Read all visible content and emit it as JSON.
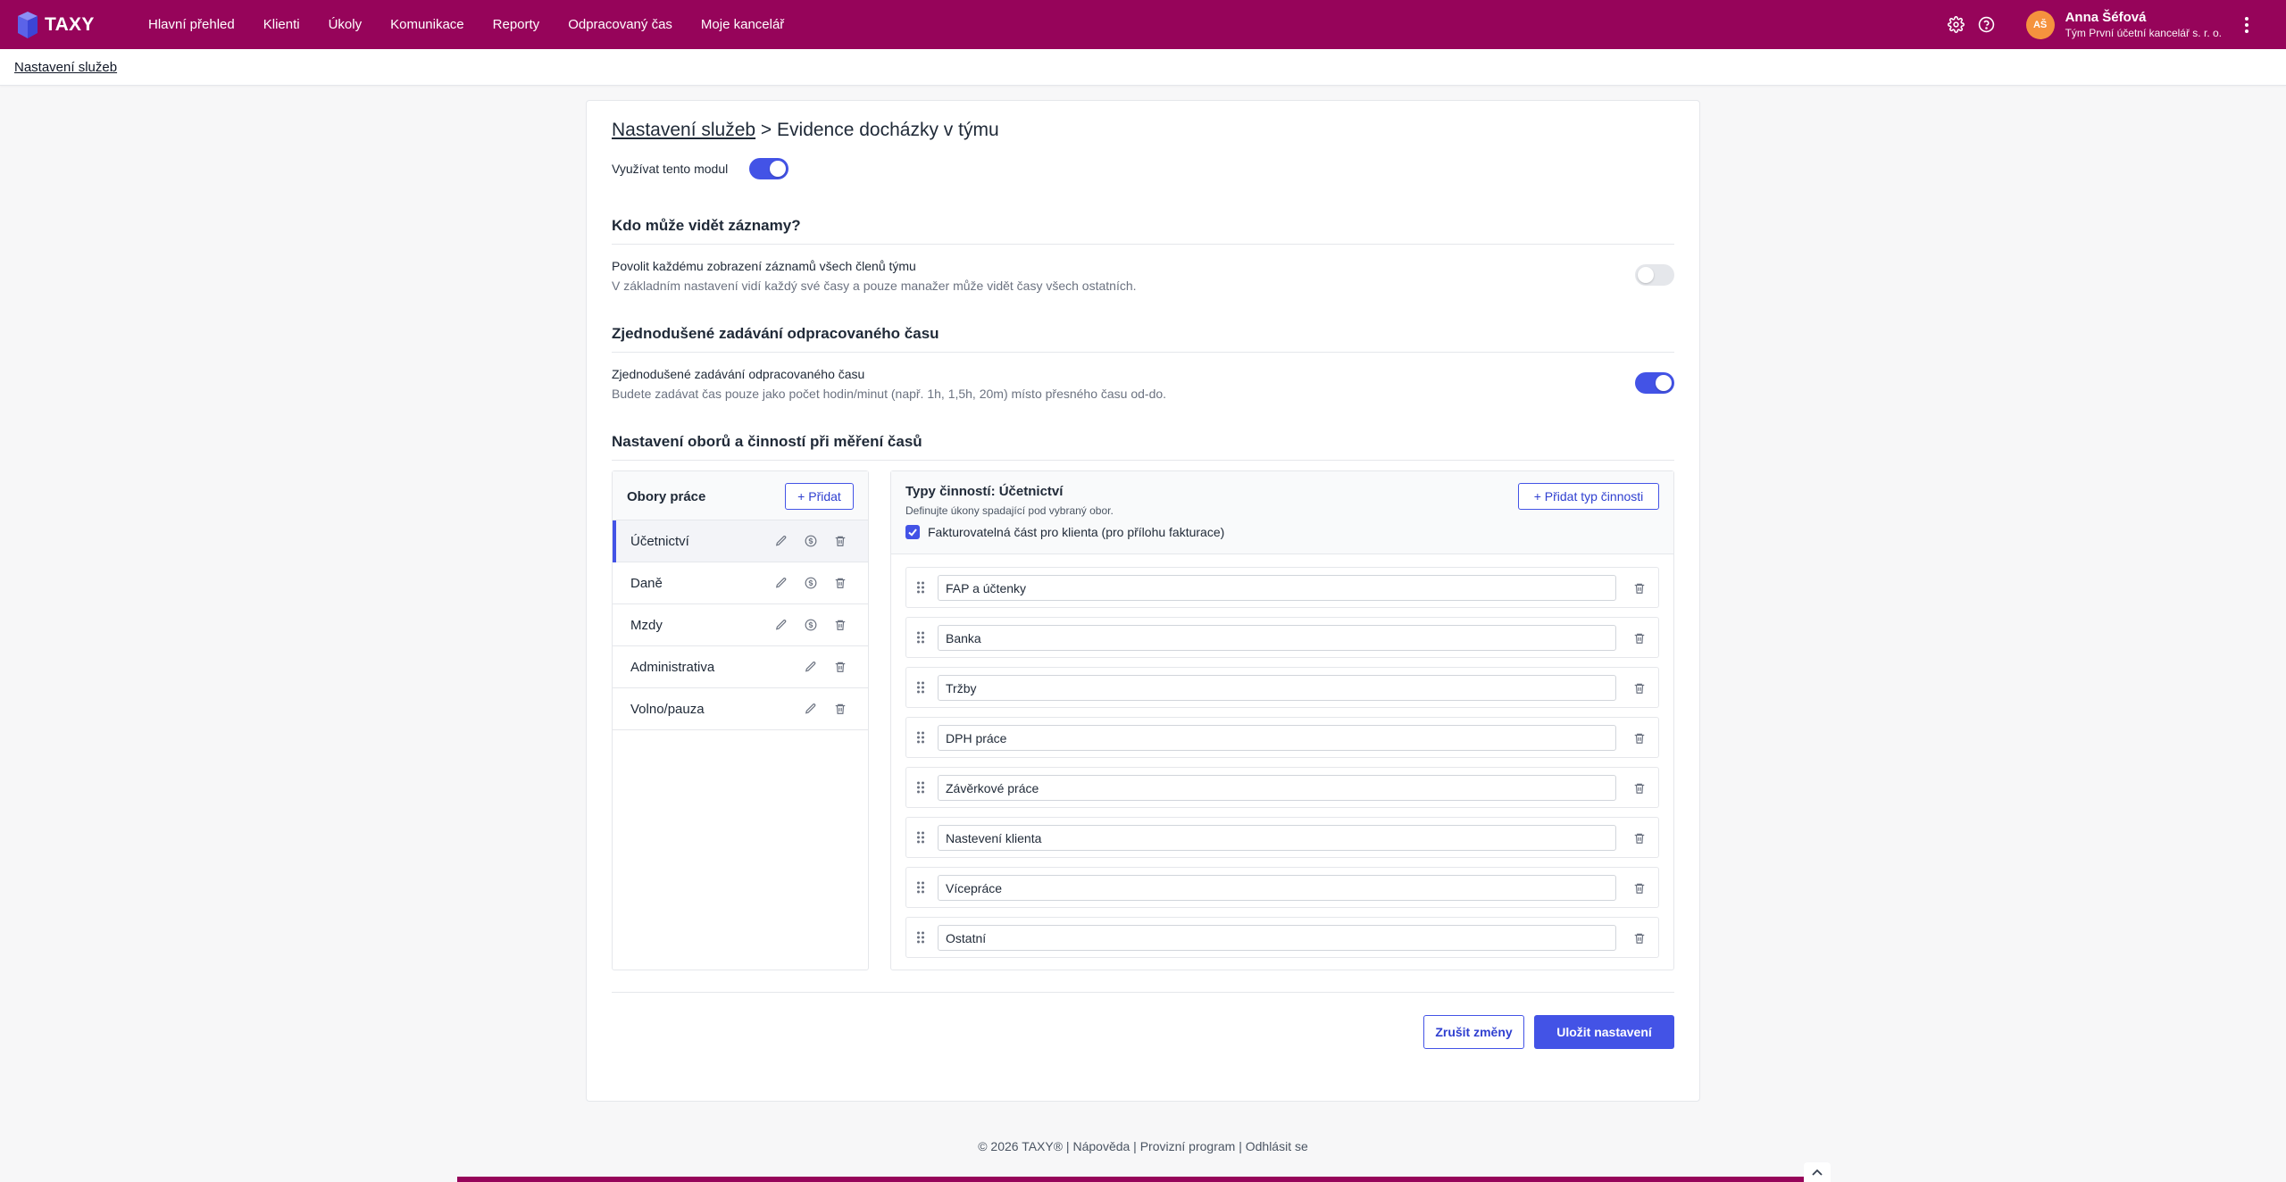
{
  "app": {
    "brand": "TAXY"
  },
  "nav": [
    "Hlavní přehled",
    "Klienti",
    "Úkoly",
    "Komunikace",
    "Reporty",
    "Odpracovaný čas",
    "Moje kancelář"
  ],
  "user": {
    "initials": "AŠ",
    "name": "Anna Šéfová",
    "org": "Tým První účetní kancelář s. r. o."
  },
  "breadcrumb": "Nastavení služeb",
  "page": {
    "crumb_link": "Nastavení služeb",
    "crumb_sep": " > ",
    "title": "Evidence docházky v týmu",
    "module_label": "Využívat tento modul",
    "module_enabled": true
  },
  "sections": {
    "visibility": {
      "heading": "Kdo může vidět záznamy?",
      "setting_title": "Povolit každému zobrazení záznamů všech členů týmu",
      "setting_desc": "V základním nastavení vidí každý své časy a pouze manažer může vidět časy všech ostatních.",
      "enabled": false
    },
    "simplified": {
      "heading": "Zjednodušené zadávání odpracovaného času",
      "setting_title": "Zjednodušené zadávání odpracovaného času",
      "setting_desc": "Budete zadávat čas pouze jako počet hodin/minut (např. 1h, 1,5h, 20m) místo přesného času od-do.",
      "enabled": true
    },
    "fields": {
      "heading": "Nastavení oborů a činností při měření časů"
    }
  },
  "work_fields": {
    "title": "Obory práce",
    "add_label": "+ Přidat",
    "items": [
      {
        "name": "Účetnictví",
        "active": true,
        "has_billing": true
      },
      {
        "name": "Daně",
        "active": false,
        "has_billing": true
      },
      {
        "name": "Mzdy",
        "active": false,
        "has_billing": true
      },
      {
        "name": "Administrativa",
        "active": false,
        "has_billing": false
      },
      {
        "name": "Volno/pauza",
        "active": false,
        "has_billing": false
      }
    ]
  },
  "activity_types": {
    "title": "Typy činností: Účetnictví",
    "subtitle": "Definujte úkony spadající pod vybraný obor.",
    "billable_label": "Fakturovatelná část pro klienta (pro přílohu fakturace)",
    "billable_checked": true,
    "add_label": "+ Přidat typ činnosti",
    "items": [
      "FAP a účtenky",
      "Banka",
      "Tržby",
      "DPH práce",
      "Závěrkové práce",
      "Nastevení klienta",
      "Vícepráce",
      "Ostatní"
    ]
  },
  "actions": {
    "cancel": "Zrušit změny",
    "save": "Uložit nastavení"
  },
  "footer": {
    "copyright": "© 2026 TAXY®",
    "help": "Nápověda",
    "affiliate": "Provizní program",
    "logout": "Odhlásit se",
    "sep": " | "
  },
  "colors": {
    "brand": "#96045a",
    "accent": "#4353e6",
    "avatar": "#f5923e"
  }
}
